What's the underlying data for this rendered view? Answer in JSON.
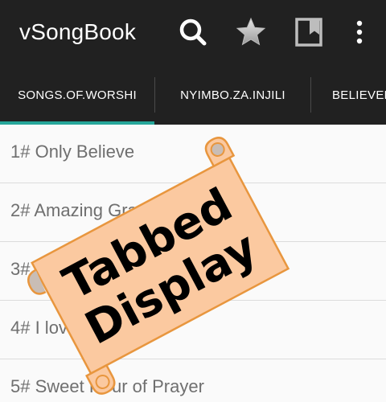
{
  "app": {
    "title": "vSongBook"
  },
  "toolbar": {
    "actions": [
      {
        "icon": "search-icon"
      },
      {
        "icon": "star-icon"
      },
      {
        "icon": "bookmark-icon"
      },
      {
        "icon": "more-vert-icon"
      }
    ]
  },
  "tabs": [
    {
      "label": "SONGS.OF.WORSHI",
      "selected": true
    },
    {
      "label": "NYIMBO.ZA.INJILI",
      "selected": false
    },
    {
      "label": "BELIEVER",
      "selected": false
    }
  ],
  "songs": [
    {
      "label": "1# Only Believe"
    },
    {
      "label": "2# Amazing Grace"
    },
    {
      "label": "3# It is Well"
    },
    {
      "label": "4# I love You Lord"
    },
    {
      "label": "5# Sweet Hour of Prayer"
    }
  ],
  "banner": {
    "line1": "Tabbed",
    "line2": "Display"
  },
  "colors": {
    "appbar": "#212121",
    "accent": "#26a69a",
    "banner_fill": "#fbc9a0",
    "banner_stroke": "#e8963e"
  }
}
